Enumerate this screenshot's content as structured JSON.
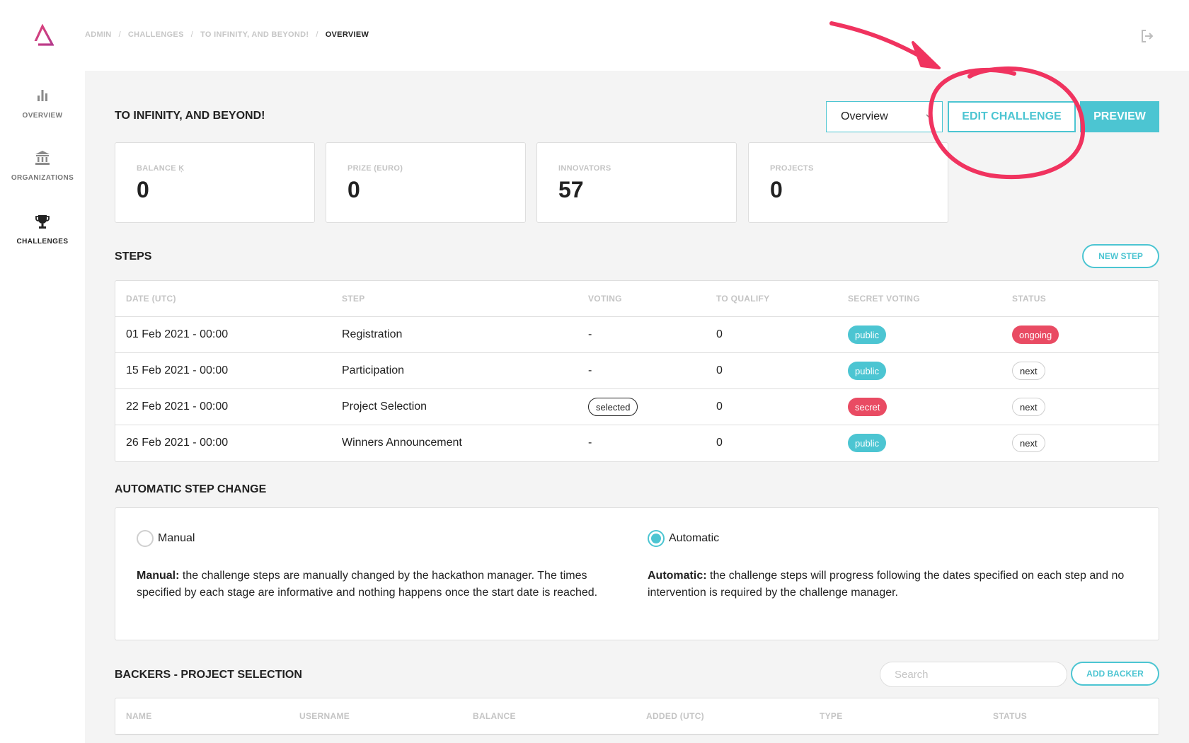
{
  "sidebar": {
    "items": [
      {
        "label": "OVERVIEW",
        "icon": "bar-chart-icon"
      },
      {
        "label": "ORGANIZATIONS",
        "icon": "institution-icon"
      },
      {
        "label": "CHALLENGES",
        "icon": "trophy-icon"
      }
    ]
  },
  "breadcrumb": {
    "items": [
      "ADMIN",
      "CHALLENGES",
      "TO INFINITY, AND BEYOND!"
    ],
    "separator": "/",
    "current": "OVERVIEW"
  },
  "header": {
    "title": "TO INFINITY, AND BEYOND!",
    "view_select": "Overview",
    "edit_label": "EDIT CHALLENGE",
    "preview_label": "PREVIEW"
  },
  "stats": [
    {
      "label": "BALANCE Ķ",
      "value": "0"
    },
    {
      "label": "PRIZE (EURO)",
      "value": "0"
    },
    {
      "label": "INNOVATORS",
      "value": "57"
    },
    {
      "label": "PROJECTS",
      "value": "0"
    }
  ],
  "steps": {
    "title": "STEPS",
    "new_label": "NEW STEP",
    "columns": [
      "DATE (UTC)",
      "STEP",
      "VOTING",
      "TO QUALIFY",
      "SECRET VOTING",
      "STATUS"
    ],
    "rows": [
      {
        "date": "01 Feb 2021 - 00:00",
        "step": "Registration",
        "voting": "-",
        "qualify": "0",
        "secret": "public",
        "status": "ongoing"
      },
      {
        "date": "15 Feb 2021 - 00:00",
        "step": "Participation",
        "voting": "-",
        "qualify": "0",
        "secret": "public",
        "status": "next"
      },
      {
        "date": "22 Feb 2021 - 00:00",
        "step": "Project Selection",
        "voting": "selected",
        "qualify": "0",
        "secret": "secret",
        "status": "next"
      },
      {
        "date": "26 Feb 2021 - 00:00",
        "step": "Winners Announcement",
        "voting": "-",
        "qualify": "0",
        "secret": "public",
        "status": "next"
      }
    ]
  },
  "auto_change": {
    "title": "AUTOMATIC STEP CHANGE",
    "manual_label": "Manual",
    "automatic_label": "Automatic",
    "selected": "automatic",
    "manual_desc_title": "Manual:",
    "manual_desc": " the challenge steps are manually changed by the hackathon manager. The times specified by each stage are informative and nothing happens once the start date is reached.",
    "automatic_desc_title": "Automatic:",
    "automatic_desc": " the challenge steps will progress following the dates specified on each step and no intervention is required by the challenge manager."
  },
  "backers": {
    "title": "BACKERS - PROJECT SELECTION",
    "search_placeholder": "Search",
    "add_label": "ADD BACKER",
    "columns": [
      "NAME",
      "USERNAME",
      "BALANCE",
      "ADDED (UTC)",
      "TYPE",
      "STATUS"
    ]
  },
  "colors": {
    "accent": "#4cc5d2",
    "danger": "#e94b63",
    "brand": "#e0447a",
    "annotation": "#f0335f"
  }
}
